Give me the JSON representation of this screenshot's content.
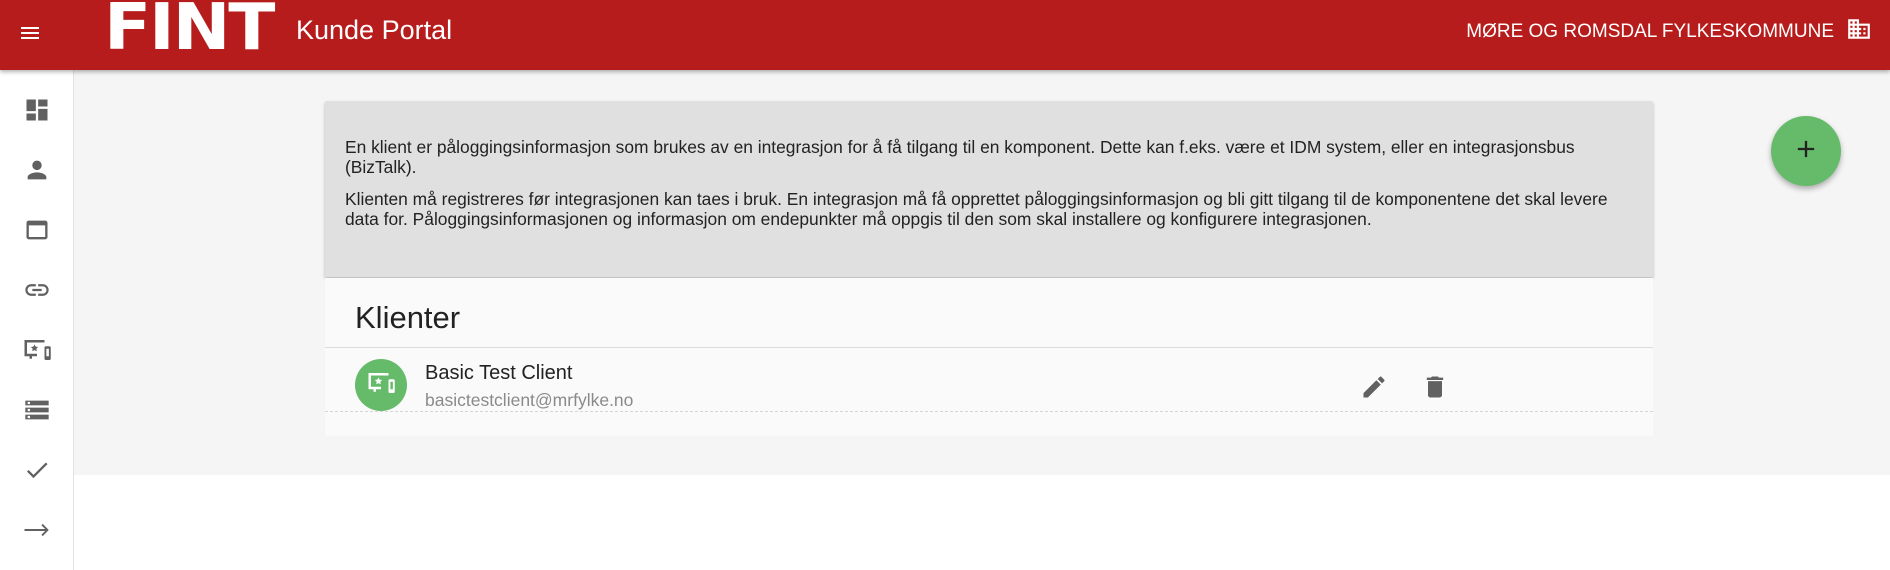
{
  "header": {
    "menu_icon": "hamburger-menu-icon",
    "logo_text": "FINT",
    "title": "Kunde Portal",
    "organization": "MØRE OG ROMSDAL FYLKESKOMMUNE",
    "organization_icon": "building-icon",
    "color": "#b71c1c"
  },
  "sidebar": {
    "items": [
      {
        "icon": "dashboard-icon"
      },
      {
        "icon": "person-icon"
      },
      {
        "icon": "window-icon"
      },
      {
        "icon": "link-icon"
      },
      {
        "icon": "client-devices-icon"
      },
      {
        "icon": "storage-icon"
      },
      {
        "icon": "check-icon"
      },
      {
        "icon": "arrow-right-icon"
      }
    ]
  },
  "info": {
    "paragraph1": "En klient er påloggingsinformasjon som brukes av en integrasjon for å få tilgang til en komponent. Dette kan f.eks. være et IDM system, eller en integrasjonsbus (BizTalk).",
    "paragraph2": "Klienten må registreres før integrasjonen kan taes i bruk. En integrasjon må få opprettet påloggingsinformasjon og bli gitt tilgang til de komponentene det skal levere data for. Påloggingsinformasjonen og informasjon om endepunkter må oppgis til den som skal installere og konfigurere integrasjonen."
  },
  "add_button": {
    "icon": "plus-icon",
    "color": "#66bb6a"
  },
  "clients": {
    "title": "Klienter",
    "items": [
      {
        "name": "Basic Test Client",
        "email": "basictestclient@mrfylke.no",
        "avatar_icon": "client-devices-icon",
        "actions": [
          "edit-icon",
          "delete-icon"
        ]
      }
    ]
  }
}
